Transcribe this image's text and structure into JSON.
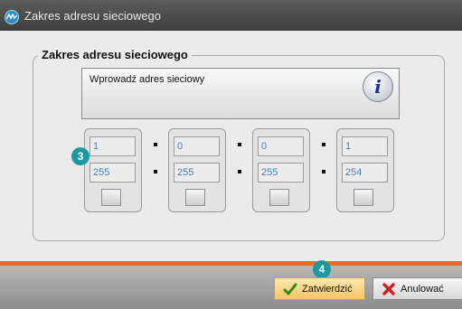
{
  "window": {
    "title": "Zakres adresu sieciowego",
    "app_icon": "app-logo-icon"
  },
  "group": {
    "title": "Zakres adresu sieciowego"
  },
  "info": {
    "text": "Wprowadź adres sieciowy",
    "icon": "info-icon"
  },
  "octets": [
    {
      "top_value": "1",
      "bottom_value": "255"
    },
    {
      "top_value": "0",
      "bottom_value": "255"
    },
    {
      "top_value": "0",
      "bottom_value": "255"
    },
    {
      "top_value": "1",
      "bottom_value": "254"
    }
  ],
  "callouts": {
    "fields_marker": "3",
    "confirm_marker": "4"
  },
  "buttons": {
    "confirm_label": "Zatwierdzić",
    "cancel_label": "Anulować"
  },
  "colors": {
    "titlebar": "#4a4a4a",
    "accent_line": "#ee6a1c",
    "callout": "#1a9aa0",
    "field_text": "#4a7db3",
    "confirm_bg": "#f7c466"
  }
}
